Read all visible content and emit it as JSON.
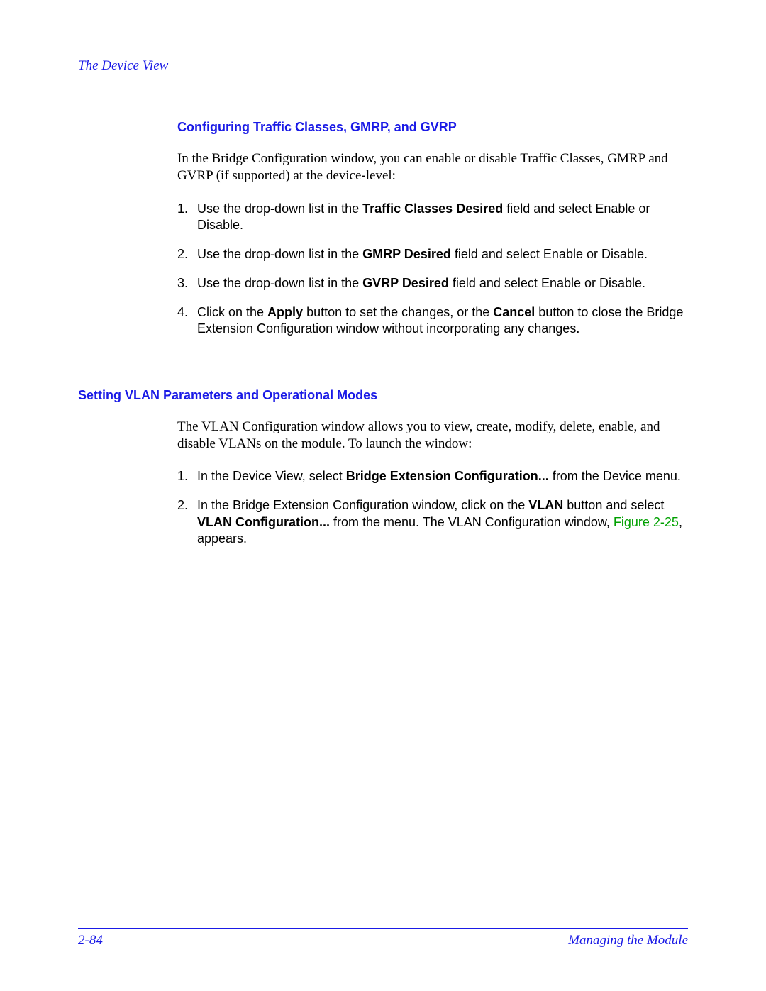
{
  "header": {
    "title": "The Device View"
  },
  "section1": {
    "heading": "Configuring Traffic Classes, GMRP, and GVRP",
    "intro": "In the Bridge Configuration window, you can enable or disable Traffic Classes, GMRP and GVRP (if supported) at the device-level:",
    "steps": [
      {
        "num": "1.",
        "pre": "Use the drop-down list in the ",
        "bold": "Traffic Classes Desired",
        "post": " field and select Enable or Disable."
      },
      {
        "num": "2.",
        "pre": "Use the drop-down list in the ",
        "bold": "GMRP Desired",
        "post": " field and select Enable or Disable."
      },
      {
        "num": "3.",
        "pre": "Use the drop-down list in the ",
        "bold": "GVRP Desired",
        "post": " field and select Enable or Disable."
      },
      {
        "num": "4.",
        "pre": "Click on the ",
        "bold": "Apply",
        "mid": " button to set the changes, or the ",
        "bold2": "Cancel",
        "post": " button to close the Bridge Extension Configuration window without incorporating any changes."
      }
    ]
  },
  "section2": {
    "heading": "Setting VLAN Parameters and Operational Modes",
    "intro": "The VLAN Configuration window allows you to view, create, modify, delete, enable, and disable VLANs on the module. To launch the window:",
    "steps": [
      {
        "num": "1.",
        "pre": "In the Device View, select ",
        "bold": "Bridge Extension Configuration...",
        "post": " from the Device menu."
      },
      {
        "num": "2.",
        "pre": "In the Bridge Extension Configuration window, click on the ",
        "bold": "VLAN",
        "mid": " button and select ",
        "bold2": "VLAN Configuration...",
        "post2": " from the menu. The VLAN Configuration window, ",
        "figref": "Figure 2-25",
        "tail": ", appears."
      }
    ]
  },
  "footer": {
    "page": "2-84",
    "chapter": "Managing the Module"
  }
}
